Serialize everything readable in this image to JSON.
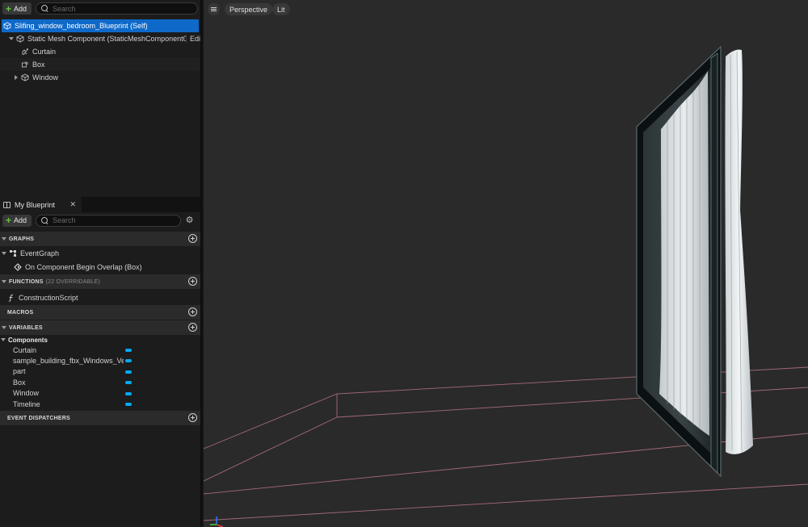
{
  "components_panel": {
    "add_label": "Add",
    "search_placeholder": "Search",
    "tree": [
      {
        "label": "Slifing_window_bedroom_Blueprint (Self)"
      },
      {
        "label": "Static Mesh Component (StaticMeshComponent0)",
        "edit": "Edi"
      },
      {
        "label": "Curtain"
      },
      {
        "label": "Box"
      },
      {
        "label": "Window"
      }
    ]
  },
  "my_blueprint": {
    "tab_label": "My Blueprint",
    "add_label": "Add",
    "search_placeholder": "Search",
    "graphs_header": "GRAPHS",
    "event_graph": "EventGraph",
    "event_item": "On Component Begin Overlap (Box)",
    "functions_header": "FUNCTIONS",
    "functions_sub": "(22 OVERRIDABLE)",
    "construction_script": "ConstructionScript",
    "macros_header": "MACROS",
    "variables_header": "VARIABLES",
    "components_category": "Components",
    "variables": [
      "Curtain",
      "sample_building_fbx_Windows_Ver",
      "part",
      "Box",
      "Window",
      "Timeline"
    ],
    "dispatchers_header": "EVENT DISPATCHERS",
    "variable_color": "#03a9f4"
  },
  "viewport": {
    "view_mode": "Perspective",
    "lighting": "Lit"
  }
}
